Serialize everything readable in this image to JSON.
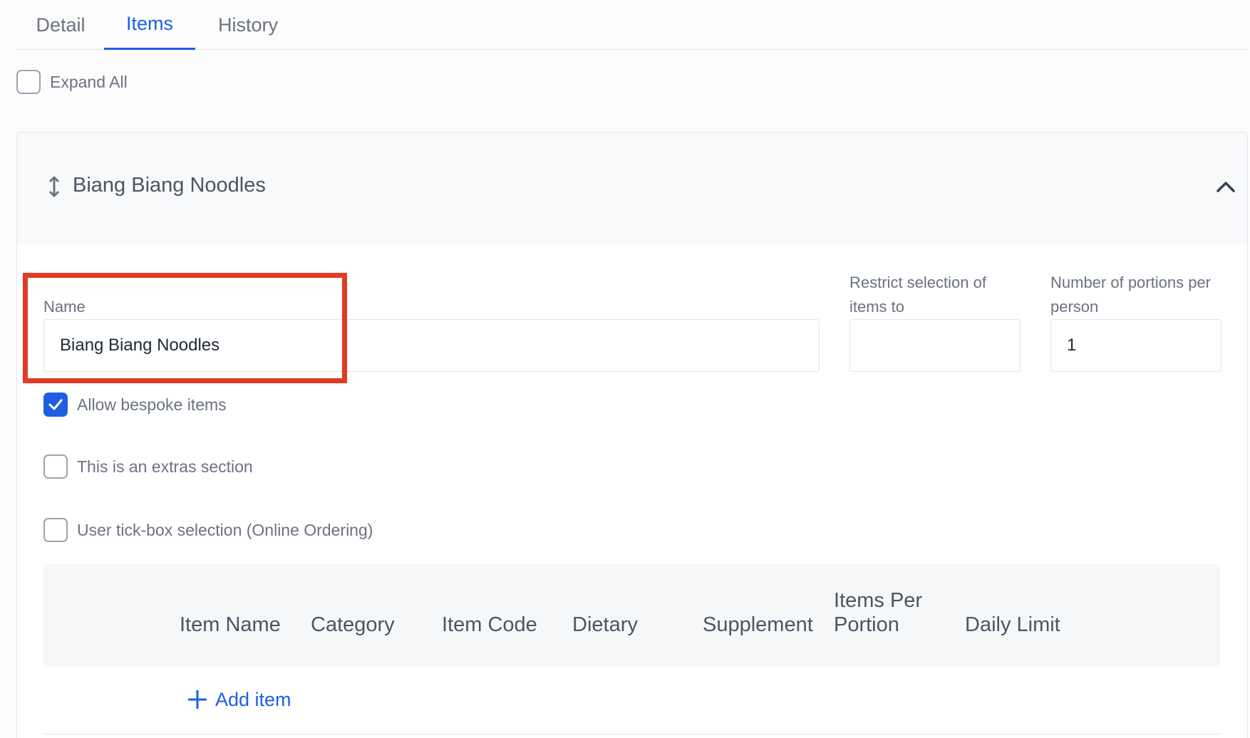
{
  "tabs": [
    {
      "label": "Detail",
      "active": false
    },
    {
      "label": "Items",
      "active": true
    },
    {
      "label": "History",
      "active": false
    }
  ],
  "expand_all": {
    "label": "Expand All",
    "checked": false
  },
  "section": {
    "title": "Biang Biang Noodles",
    "name_label": "Name",
    "name_value": "Biang Biang Noodles",
    "restrict_label_line1": "Restrict selection of",
    "restrict_label_line2": "items to",
    "restrict_value": "",
    "portions_label_line1": "Number of portions per",
    "portions_label_line2": "person",
    "portions_value": "1",
    "options": [
      {
        "label": "Allow bespoke items",
        "checked": true
      },
      {
        "label": "This is an extras section",
        "checked": false
      },
      {
        "label": "User tick-box selection (Online Ordering)",
        "checked": false
      }
    ],
    "table_headers": {
      "item_name": "Item Name",
      "category": "Category",
      "item_code": "Item Code",
      "dietary": "Dietary",
      "supplement": "Supplement",
      "items_per_portion_line1": "Items Per",
      "items_per_portion_line2": "Portion",
      "daily_limit": "Daily Limit"
    },
    "add_item_label": "Add item"
  },
  "colors": {
    "accent": "#1d5fe0",
    "highlight": "#e33b22"
  }
}
